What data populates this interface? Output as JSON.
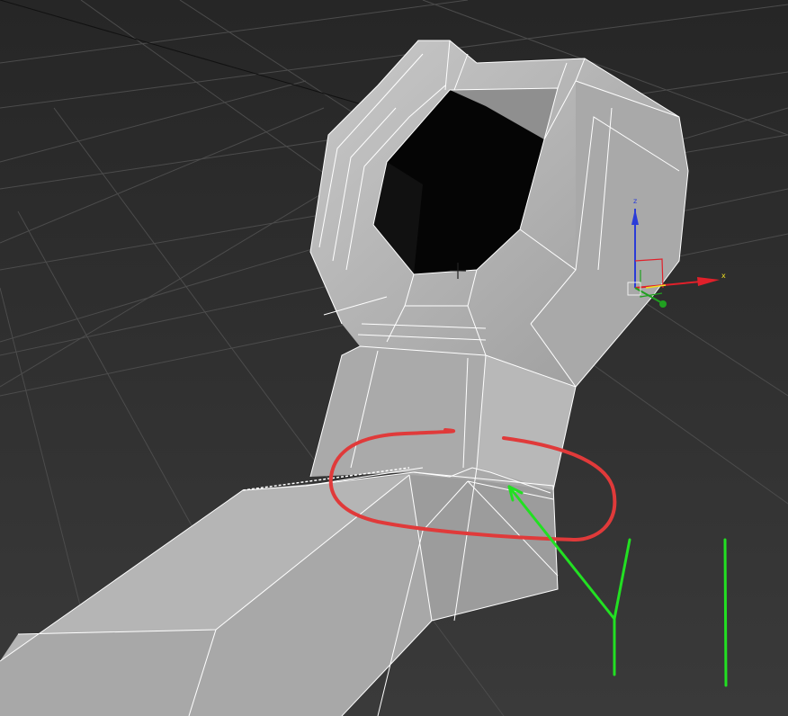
{
  "viewport": {
    "background": "#2f2f2f",
    "grid_color": "#4a4a4a",
    "mesh_light": "#bdbdbd",
    "mesh_mid": "#a4a4a4",
    "mesh_dark": "#8e8e8e",
    "wire_color": "#ffffff",
    "hole_color": "#050505"
  },
  "gizmo": {
    "x_label": "x",
    "z_label": "z",
    "x_color": "#e0202a",
    "y_color": "#20a020",
    "z_color": "#2a3cd8",
    "highlight_color": "#f0e020"
  },
  "annotations": {
    "circle_color": "#e03a3a",
    "arrow_color": "#22e022"
  }
}
